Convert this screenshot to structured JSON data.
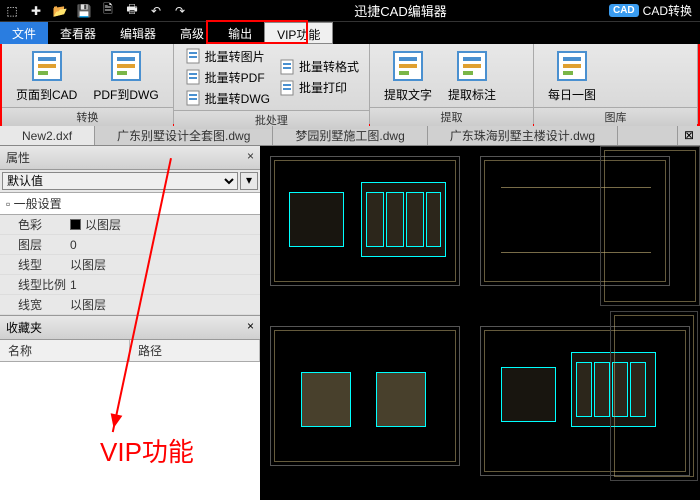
{
  "titlebar": {
    "app_title": "迅捷CAD编辑器",
    "cad_badge": "CAD",
    "convert": "CAD转换"
  },
  "menu": {
    "items": [
      "文件",
      "查看器",
      "编辑器",
      "高级",
      "输出",
      "VIP功能"
    ],
    "active": 0,
    "vip": 5
  },
  "ribbon": {
    "groups": [
      {
        "label": "转换",
        "big": [
          {
            "t": "页面到CAD"
          },
          {
            "t": "PDF到DWG"
          }
        ]
      },
      {
        "label": "批处理",
        "small": [
          [
            "批量转图片",
            "批量转格式"
          ],
          [
            "批量转PDF",
            "批量打印"
          ],
          [
            "批量转DWG",
            ""
          ]
        ]
      },
      {
        "label": "提取",
        "big": [
          {
            "t": "提取文字"
          },
          {
            "t": "提取标注"
          }
        ]
      },
      {
        "label": "图库",
        "big": [
          {
            "t": "每日一图"
          }
        ]
      }
    ]
  },
  "tabs": [
    "New2.dxf",
    "广东别墅设计全套图.dwg",
    "梦园别墅施工图.dwg",
    "广东珠海别墅主楼设计.dwg"
  ],
  "props": {
    "header": "属性",
    "default": "默认值",
    "section": "一般设置",
    "rows": [
      {
        "k": "色彩",
        "v": "以图层",
        "swatch": true
      },
      {
        "k": "图层",
        "v": "0"
      },
      {
        "k": "线型",
        "v": "以图层"
      },
      {
        "k": "线型比例",
        "v": "1"
      },
      {
        "k": "线宽",
        "v": "以图层"
      }
    ]
  },
  "fav": {
    "header": "收藏夹",
    "cols": [
      "名称",
      "路径"
    ]
  },
  "annotation": "VIP功能"
}
